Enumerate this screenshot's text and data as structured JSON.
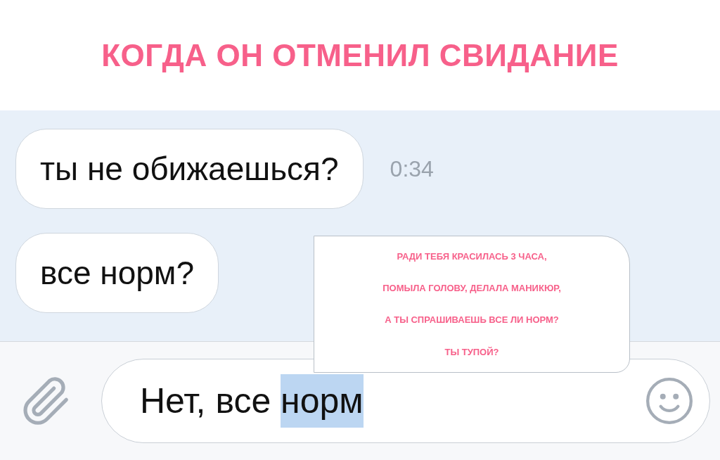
{
  "caption": "КОГДА ОН ОТМЕНИЛ СВИДАНИЕ",
  "messages": [
    {
      "text": "ты не обижаешься?",
      "time": "0:34"
    },
    {
      "text": "все норм?"
    }
  ],
  "overlay_note": {
    "lines": [
      "РАДИ ТЕБЯ КРАСИЛАСЬ 3 ЧАСА,",
      "ПОМЫЛА ГОЛОВУ, ДЕЛАЛА МАНИКЮР,",
      "А ТЫ СПРАШИВАЕШЬ ВСЕ ЛИ НОРМ?",
      "ТЫ ТУПОЙ?"
    ]
  },
  "composer": {
    "value": [
      {
        "text": "Нет, все ",
        "selected": false
      },
      {
        "text": "норм",
        "selected": true
      }
    ]
  }
}
